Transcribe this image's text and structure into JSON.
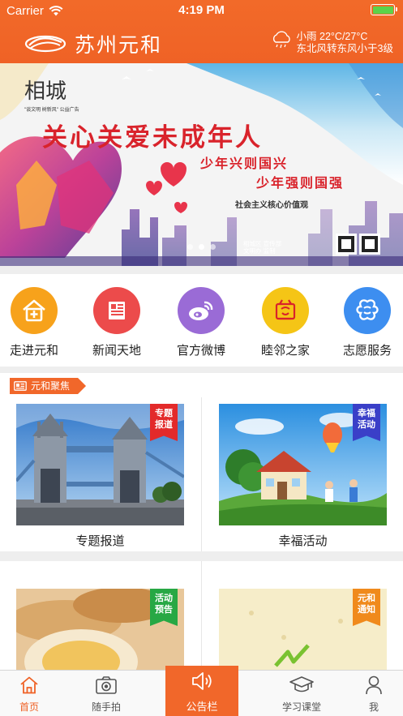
{
  "status_bar": {
    "carrier": "Carrier",
    "time": "4:19 PM"
  },
  "header": {
    "title": "苏州元和",
    "weather": {
      "line1": "小雨 22°C/27°C",
      "line2": "东北风转东风小于3级"
    }
  },
  "banner": {
    "logo": "相城",
    "logo_slogan": "\"谈文明 树新风\" 公益广告",
    "headline": "关心关爱未成年人",
    "sub1": "少年兴则国兴",
    "sub2": "少年强则国强",
    "values_title": "社会主义核心价值观",
    "credit_line1": "相城区  宣传部",
    "credit_line2": "文明办  监制",
    "slides": 3,
    "active_slide": 2
  },
  "quick_menu": [
    {
      "label": "走进元和",
      "icon": "home-plus-icon",
      "color": "#f7a21b"
    },
    {
      "label": "新闻天地",
      "icon": "newspaper-icon",
      "color": "#ec4b4b"
    },
    {
      "label": "官方微博",
      "icon": "weibo-icon",
      "color": "#9a6bd6"
    },
    {
      "label": "睦邻之家",
      "icon": "neighbor-house-icon",
      "color": "#f5c516"
    },
    {
      "label": "志愿服务",
      "icon": "volunteer-icon",
      "color": "#3d8ef0"
    }
  ],
  "section": {
    "title": "元和聚焦"
  },
  "cards": [
    {
      "title": "专题报道",
      "ribbon": "专题\n报道",
      "ribbon_color": "#e32a2a"
    },
    {
      "title": "幸福活动",
      "ribbon": "幸福\n活动",
      "ribbon_color": "#3a3fc8"
    },
    {
      "title": "",
      "ribbon": "活动\n预告",
      "ribbon_color": "#27a844"
    },
    {
      "title": "",
      "ribbon": "元和\n通知",
      "ribbon_color": "#f08a1c"
    }
  ],
  "tabbar": [
    {
      "label": "首页",
      "icon": "home-icon"
    },
    {
      "label": "随手拍",
      "icon": "camera-icon"
    },
    {
      "label": "公告栏",
      "icon": "speaker-icon"
    },
    {
      "label": "学习课堂",
      "icon": "graduation-cap-icon"
    },
    {
      "label": "我",
      "icon": "user-icon"
    }
  ],
  "colors": {
    "brand": "#ef6226",
    "tab_active": "#ef6226"
  }
}
